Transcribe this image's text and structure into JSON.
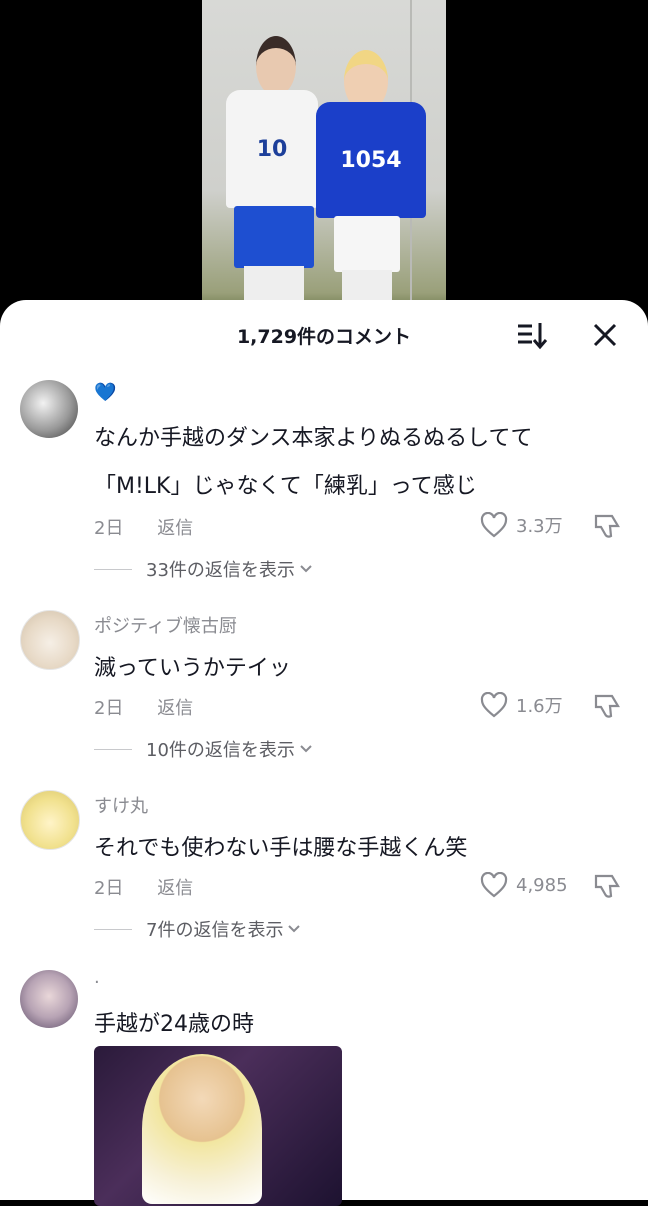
{
  "header": {
    "title": "1,729件のコメント"
  },
  "comments": [
    {
      "username": "💙",
      "lines": [
        "なんか手越のダンス本家よりぬるぬるしてて",
        "「M!LK」じゃなくて「練乳」って感じ"
      ],
      "time": "2日",
      "reply_label": "返信",
      "likes": "3.3万",
      "view_replies": "33件の返信を表示"
    },
    {
      "username": "ポジティブ懐古厨",
      "lines": [
        "滅っていうかテイッ"
      ],
      "time": "2日",
      "reply_label": "返信",
      "likes": "1.6万",
      "view_replies": "10件の返信を表示"
    },
    {
      "username": "すけ丸",
      "lines": [
        "それでも使わない手は腰な手越くん笑"
      ],
      "time": "2日",
      "reply_label": "返信",
      "likes": "4,985",
      "view_replies": "7件の返信を表示"
    },
    {
      "username": "·",
      "lines": [
        "手越が24歳の時"
      ]
    }
  ],
  "video": {
    "jersey_left": "10",
    "jersey_right": "1054"
  },
  "colors": {
    "heart": "#8a8b91",
    "sheet_bg": "#ffffff",
    "backdrop": "#000000"
  }
}
